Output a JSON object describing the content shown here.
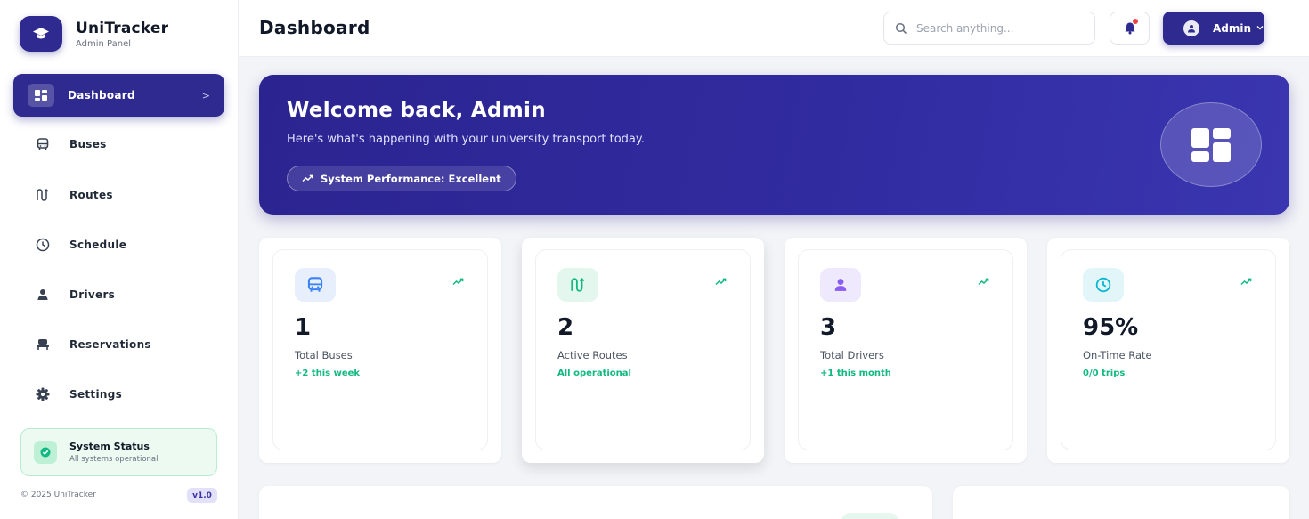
{
  "brand": {
    "title": "UniTracker",
    "subtitle": "Admin Panel",
    "icon": "graduation-cap-icon"
  },
  "sidebar": {
    "items": [
      {
        "label": "Dashboard",
        "icon": "dashboard-icon",
        "active": true
      },
      {
        "label": "Buses",
        "icon": "bus-icon",
        "active": false
      },
      {
        "label": "Routes",
        "icon": "route-icon",
        "active": false
      },
      {
        "label": "Schedule",
        "icon": "clock-icon",
        "active": false
      },
      {
        "label": "Drivers",
        "icon": "user-icon",
        "active": false
      },
      {
        "label": "Reservations",
        "icon": "seat-icon",
        "active": false
      },
      {
        "label": "Settings",
        "icon": "gear-icon",
        "active": false
      }
    ],
    "status": {
      "title": "System Status",
      "subtitle": "All systems operational"
    },
    "copyright": "© 2025 UniTracker",
    "version": "v1.0"
  },
  "header": {
    "title": "Dashboard",
    "search_placeholder": "Search anything...",
    "user_label": "Admin"
  },
  "hero": {
    "title": "Welcome back, Admin",
    "subtitle": "Here's what's happening with your university transport today.",
    "pill": "System Performance: Excellent"
  },
  "stats": [
    {
      "value": "1",
      "label": "Total Buses",
      "delta": "+2 this week",
      "icon": "bus-icon",
      "color": "#3b82f6"
    },
    {
      "value": "2",
      "label": "Active Routes",
      "delta": "All operational",
      "icon": "route-icon",
      "color": "#10b981"
    },
    {
      "value": "3",
      "label": "Total Drivers",
      "delta": "+1 this month",
      "icon": "user-icon",
      "color": "#8b5cf6"
    },
    {
      "value": "95%",
      "label": "On-Time Rate",
      "delta": "0/0 trips",
      "icon": "clock-icon",
      "color": "#06b6d4"
    }
  ],
  "colors": {
    "primary": "#2e2a8f",
    "success": "#10b981",
    "danger": "#ef4444",
    "background": "#f3f4f7"
  }
}
